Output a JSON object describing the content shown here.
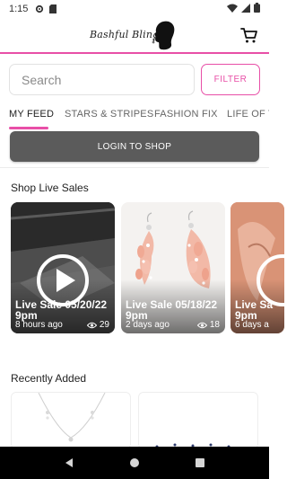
{
  "status_bar": {
    "time": "1:15",
    "icons": [
      "settings-gear-icon",
      "sd-card-icon",
      "wifi-icon",
      "cellular-signal-icon",
      "battery-icon"
    ]
  },
  "header": {
    "logo_text": "Bashful Bling",
    "cart_icon": "cart-icon",
    "accent_color": "#e84fa7"
  },
  "search": {
    "placeholder": "Search",
    "value": "",
    "filter_label": "FILTER"
  },
  "tabs": [
    {
      "label": "MY FEED",
      "active": true
    },
    {
      "label": "STARS & STRIPES",
      "active": false
    },
    {
      "label": "FASHION FIX",
      "active": false
    },
    {
      "label": "LIFE OF TI",
      "active": false
    }
  ],
  "login_button": "LOGIN TO SHOP",
  "shop_live": {
    "title": "Shop Live Sales",
    "cards": [
      {
        "title": "Live Sale 05/20/22 9pm",
        "time_ago": "8 hours ago",
        "views": "29",
        "has_play": true
      },
      {
        "title": "Live Sale 05/18/22 9pm",
        "time_ago": "2 days ago",
        "views": "18",
        "has_play": false
      },
      {
        "title": "Live Sa 9pm",
        "time_ago": "6 days a",
        "views": "",
        "has_play": true
      }
    ]
  },
  "recently_added": {
    "title": "Recently Added"
  },
  "nav_bar": {
    "icons": [
      "back-icon",
      "home-icon",
      "recents-icon"
    ]
  }
}
